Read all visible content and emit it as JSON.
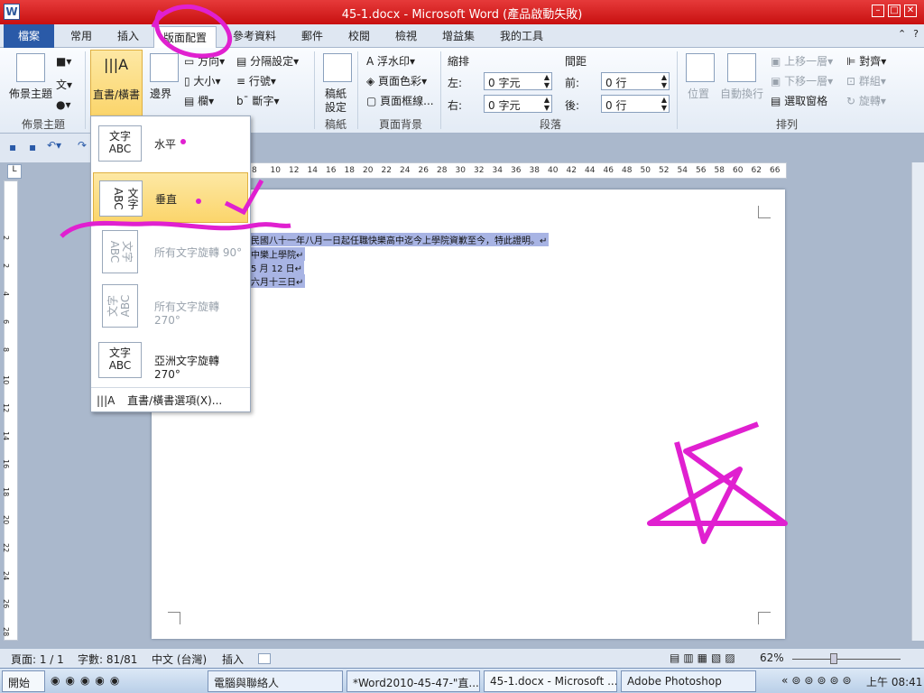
{
  "window": {
    "title": "45-1.docx - Microsoft Word (產品啟動失敗)",
    "app_icon": "W"
  },
  "tabs": [
    "檔案",
    "常用",
    "插入",
    "版面配置",
    "參考資料",
    "郵件",
    "校閱",
    "檢視",
    "增益集",
    "我的工具"
  ],
  "ribbon": {
    "theme": {
      "label": "佈景主題",
      "group": "佈景主題"
    },
    "textdir": {
      "label": "直書/橫書"
    },
    "margins": {
      "label": "邊界"
    },
    "orient": "方向",
    "size": "大小",
    "columns": "欄",
    "breaks": "分隔設定",
    "linenum": "行號",
    "hyphen": "斷字",
    "manuscript": {
      "label1": "稿紙",
      "label2": "設定",
      "group": "稿紙"
    },
    "watermark": "浮水印",
    "pagecolor": "頁面色彩",
    "pageborder": "頁面框線...",
    "pagebg_group": "頁面背景",
    "indent": {
      "title": "縮排",
      "left_label": "左:",
      "left_value": "0 字元",
      "right_label": "右:",
      "right_value": "0 字元"
    },
    "spacing": {
      "title": "間距",
      "before_label": "前:",
      "before_value": "0 行",
      "after_label": "後:",
      "after_value": "0 行"
    },
    "para_group": "段落",
    "position": "位置",
    "wrap": "自動換行",
    "bringfwd": "上移一層",
    "sendback": "下移一層",
    "selpane": "選取窗格",
    "align": "對齊",
    "group": "群組",
    "rotate": "旋轉",
    "arrange_group": "排列"
  },
  "dropdown": {
    "items": [
      {
        "icon_top": "文字",
        "icon_bottom": "ABC",
        "label": "水平"
      },
      {
        "icon_top": "文字",
        "icon_bottom": "ABC",
        "label": "垂直"
      },
      {
        "icon_top": "文字",
        "icon_bottom": "ABC",
        "label": "所有文字旋轉 90°"
      },
      {
        "icon_top": "文字",
        "icon_bottom": "ABC",
        "label": "所有文字旋轉 270°"
      },
      {
        "icon_top": "文字",
        "icon_bottom": "ABC",
        "label": "亞洲文字旋轉 270°"
      }
    ],
    "options_label": "直書/橫書選項(X)..."
  },
  "ruler": {
    "h_ticks": [
      "8",
      "10",
      "12",
      "14",
      "16",
      "18",
      "20",
      "22",
      "24",
      "26",
      "28",
      "30",
      "32",
      "34",
      "36",
      "38",
      "40",
      "42",
      "44",
      "46",
      "48",
      "50",
      "52",
      "54",
      "56",
      "58",
      "60",
      "62",
      "66"
    ],
    "v_ticks": [
      "2",
      "2",
      "4",
      "6",
      "8",
      "10",
      "12",
      "14",
      "16",
      "18",
      "20",
      "22",
      "24",
      "26",
      "28",
      "30"
    ]
  },
  "document": {
    "lines": [
      "民國八十一年八月一日起任職快樂高中迄今上學院資歉至今，特此證明。↵",
      "中樂上學院↵",
      "5 月 12 日↵",
      "六月十三日↵"
    ]
  },
  "status": {
    "page": "頁面: 1 / 1",
    "words": "字數: 81/81",
    "lang": "中文 (台灣)",
    "mode": "插入",
    "zoom": "62%"
  },
  "taskbar": {
    "start": "開始",
    "tasks": [
      "電腦與聯絡人",
      "*Word2010-45-47-\"直...",
      "45-1.docx - Microsoft ...",
      "Adobe Photoshop"
    ],
    "clock": "上午 08:41"
  },
  "colors": {
    "title_red": "#d42020",
    "file_tab": "#2a5aa8",
    "annotation": "#e020d0",
    "highlight": "#a8b4e4"
  }
}
